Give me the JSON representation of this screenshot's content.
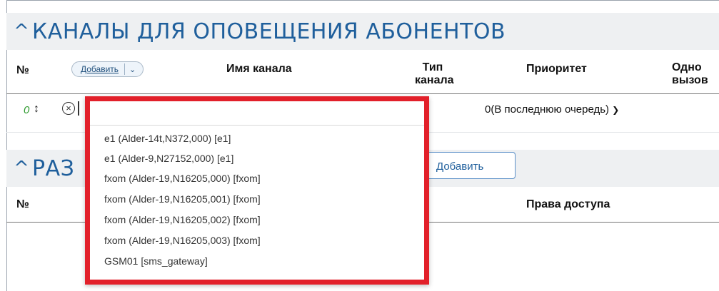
{
  "section1": {
    "title": "КАНАЛЫ ДЛЯ ОПОВЕЩЕНИЯ АБОНЕНТОВ",
    "columns": {
      "num": "№",
      "add_label": "Добавить",
      "name": "Имя канала",
      "type_line1": "Тип",
      "type_line2": "канала",
      "priority": "Приоритет",
      "single_line1": "Одно",
      "single_line2": "вызов"
    },
    "row": {
      "num": "0",
      "priority_value": "0(В последнюю очередь)"
    }
  },
  "section2": {
    "title": "РАЗ",
    "add_button": "Добавить",
    "columns": {
      "num": "№",
      "access": "Права доступа"
    }
  },
  "dropdown": {
    "search_value": "",
    "options": [
      "e1 (Alder-14t,N372,000) [e1]",
      "e1 (Alder-9,N27152,000) [e1]",
      "fxom (Alder-19,N16205,000) [fxom]",
      "fxom (Alder-19,N16205,001) [fxom]",
      "fxom (Alder-19,N16205,002) [fxom]",
      "fxom (Alder-19,N16205,003) [fxom]",
      "GSM01 [sms_gateway]"
    ]
  },
  "colors": {
    "accent": "#1f5f9c",
    "highlight_border": "#e2202a",
    "green_number": "#2e9a2e"
  },
  "icons": {
    "collapse": "chevron-up-icon",
    "sort": "up-down-arrow-icon",
    "remove": "close-circle-icon",
    "dropdown": "chevron-down-icon"
  }
}
